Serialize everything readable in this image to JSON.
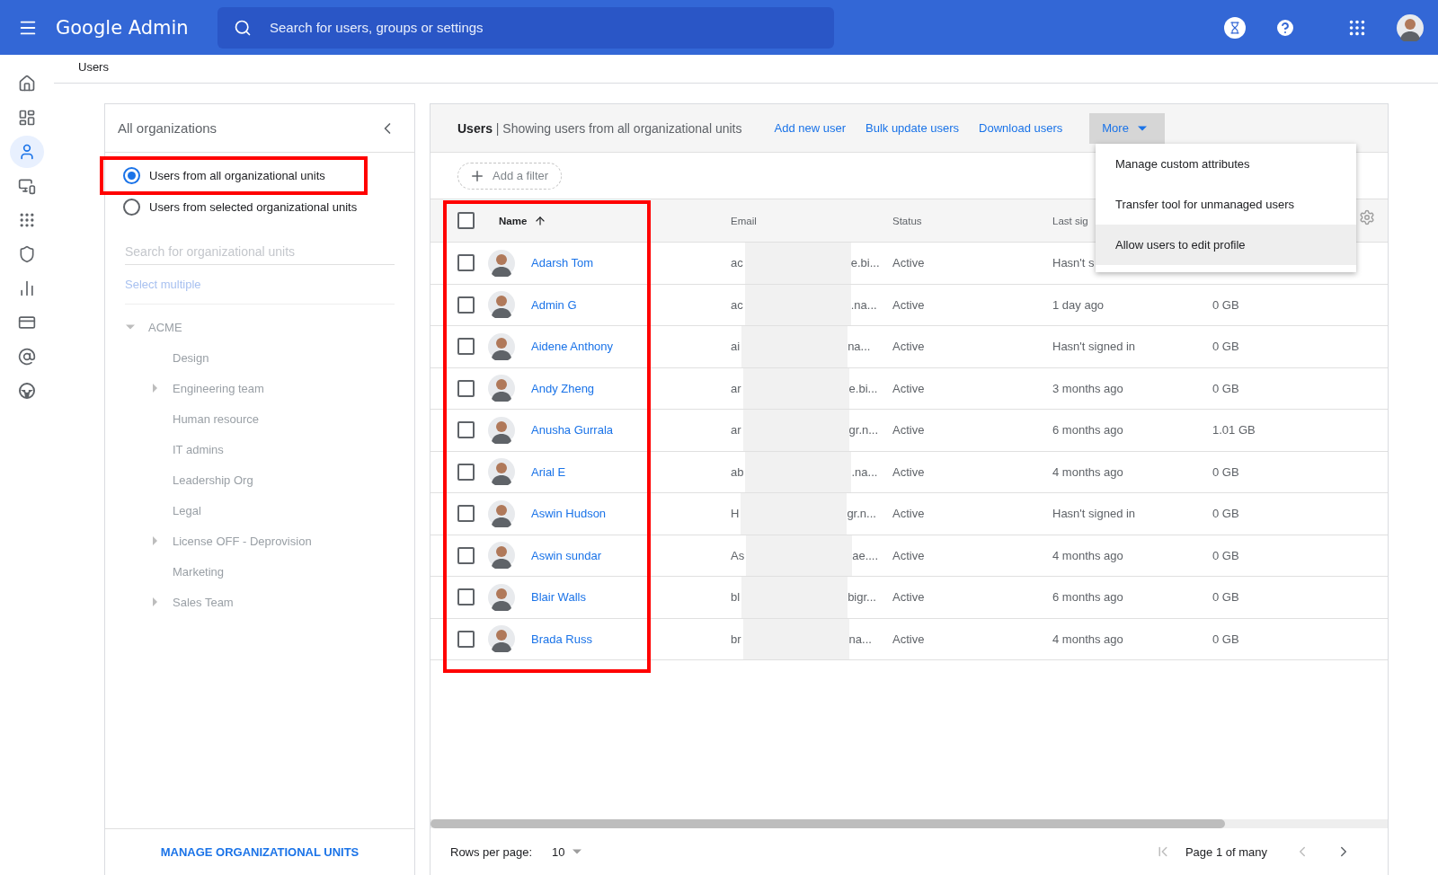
{
  "top_bar": {
    "product": "Google Admin",
    "search": {
      "placeholder": "Search for users, groups or settings"
    }
  },
  "nav_rail": [
    {
      "kind": "home",
      "selected": false
    },
    {
      "kind": "dashboard",
      "selected": false
    },
    {
      "kind": "users",
      "selected": true
    },
    {
      "kind": "devices",
      "selected": false
    },
    {
      "kind": "apps",
      "selected": false
    },
    {
      "kind": "security",
      "selected": false
    },
    {
      "kind": "reports",
      "selected": false
    },
    {
      "kind": "billing",
      "selected": false
    },
    {
      "kind": "account",
      "selected": false
    },
    {
      "kind": "rules",
      "selected": false
    }
  ],
  "breadcrumb": "Users",
  "org_panel": {
    "title": "All organizations",
    "scope_options": [
      {
        "label": "Users from all organizational units",
        "selected": true,
        "highlighted": true
      },
      {
        "label": "Users from selected organizational units",
        "selected": false,
        "highlighted": false
      }
    ],
    "search": {
      "placeholder": "Search for organizational units"
    },
    "select_multiple": "Select multiple",
    "tree": [
      {
        "label": "ACME",
        "expandable": true,
        "expanded": true,
        "children": [
          {
            "label": "Design",
            "expandable": false,
            "expanded": false
          },
          {
            "label": "Engineering team",
            "expandable": true,
            "expanded": false
          },
          {
            "label": "Human resource",
            "expandable": false,
            "expanded": false
          },
          {
            "label": "IT admins",
            "expandable": false,
            "expanded": false
          },
          {
            "label": "Leadership Org",
            "expandable": false,
            "expanded": false
          },
          {
            "label": "Legal",
            "expandable": false,
            "expanded": false
          },
          {
            "label": "License OFF - Deprovision",
            "expandable": true,
            "expanded": false
          },
          {
            "label": "Marketing",
            "expandable": false,
            "expanded": false
          },
          {
            "label": "Sales Team",
            "expandable": true,
            "expanded": false
          }
        ]
      }
    ],
    "manage_button": "MANAGE ORGANIZATIONAL UNITS"
  },
  "users_panel": {
    "title": "Users",
    "separator": "|",
    "subtitle": "Showing users from all organizational units",
    "actions": [
      "Add new user",
      "Bulk update users",
      "Download users"
    ],
    "more_button": "More",
    "more_menu": [
      {
        "label": "Manage custom attributes",
        "highlighted": false
      },
      {
        "label": "Transfer tool for unmanaged users",
        "highlighted": false
      },
      {
        "label": "Allow users to edit profile",
        "highlighted": true
      }
    ],
    "add_filter": "Add a filter",
    "table": {
      "select_all_checked": false,
      "name_column_highlighted": true,
      "columns": [
        "Name",
        "Email",
        "Status",
        "Last sig"
      ],
      "rows": [
        {
          "checked": false,
          "name": "Adarsh Tom",
          "email_start": "ac",
          "email_end": "e.bi...",
          "status": "Active",
          "last_sign_in": "Hasn't s"
        },
        {
          "checked": false,
          "name": "Admin G",
          "email_start": "ac",
          "email_end": ".na...",
          "status": "Active",
          "last_sign_in": "1 day ago",
          "storage": "0 GB"
        },
        {
          "checked": false,
          "name": "Aidene Anthony",
          "email_start": "ai",
          "email_end": "na...",
          "status": "Active",
          "last_sign_in": "Hasn't signed in",
          "storage": "0 GB"
        },
        {
          "checked": false,
          "name": "Andy Zheng",
          "email_start": "ar",
          "email_end": "e.bi...",
          "status": "Active",
          "last_sign_in": "3 months ago",
          "storage": "0 GB"
        },
        {
          "checked": false,
          "name": "Anusha Gurrala",
          "email_start": "ar",
          "email_end": "gr.n...",
          "status": "Active",
          "last_sign_in": "6 months ago",
          "storage": "1.01 GB"
        },
        {
          "checked": false,
          "name": "Arial E",
          "email_start": "ab",
          "email_end": ".na...",
          "status": "Active",
          "last_sign_in": "4 months ago",
          "storage": "0 GB"
        },
        {
          "checked": false,
          "name": "Aswin Hudson",
          "email_start": "H",
          "email_end": "gr.n...",
          "status": "Active",
          "last_sign_in": "Hasn't signed in",
          "storage": "0 GB"
        },
        {
          "checked": false,
          "name": "Aswin sundar",
          "email_start": "As",
          "email_end": "ae....",
          "status": "Active",
          "last_sign_in": "4 months ago",
          "storage": "0 GB"
        },
        {
          "checked": false,
          "name": "Blair Walls",
          "email_start": "bl",
          "email_end": "bigr...",
          "status": "Active",
          "last_sign_in": "6 months ago",
          "storage": "0 GB"
        },
        {
          "checked": false,
          "name": "Brada Russ",
          "email_start": "br",
          "email_end": "na...",
          "status": "Active",
          "last_sign_in": "4 months ago",
          "storage": "0 GB"
        }
      ]
    },
    "footer": {
      "rows_per_page_label": "Rows per page:",
      "rows_per_page": "10",
      "page_label": "Page 1 of many"
    }
  }
}
